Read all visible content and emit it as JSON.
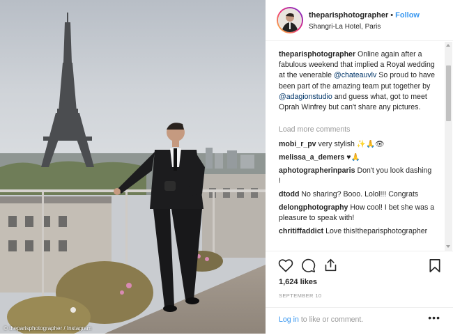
{
  "photo": {
    "watermark": "© theparisphotographer / Instagram"
  },
  "header": {
    "username": "theparisphotographer",
    "separator": "•",
    "follow_label": "Follow",
    "location": "Shangri-La Hotel, Paris"
  },
  "caption": {
    "username": "theparisphotographer",
    "part1": "Online again after a fabulous weekend that implied a Royal wedding at the venerable",
    "mention1": "@chateauvlv",
    "part2": "So proud to have been part of the amazing team put together by",
    "mention2": "@adagionstudio",
    "part3": "and guess what, got to meet Oprah Winfrey but can't share any pictures."
  },
  "load_more_label": "Load more comments",
  "comments": [
    {
      "username": "mobi_r_pv",
      "text": "very stylish ✨🙏👁"
    },
    {
      "username": "melissa_a_demers",
      "text": "♥🙏"
    },
    {
      "username": "aphotographerinparis",
      "text": "Don't you look dashing !"
    },
    {
      "username": "dtodd",
      "text": "No sharing? Booo. Lolol!!! Congrats"
    },
    {
      "username": "delongphotography",
      "text": "How cool! I bet she was a pleasure to speak with!"
    },
    {
      "username": "chritiffaddict",
      "text": "Love this!theparisphotographer"
    }
  ],
  "footer": {
    "icons": [
      "heart-icon",
      "comment-icon",
      "share-icon",
      "bookmark-icon"
    ],
    "likes": "1,624 likes",
    "date": "SEPTEMBER 10",
    "login_link": "Log in",
    "login_rest": "to like or comment.",
    "more_label": "•••"
  },
  "colors": {
    "link_blue": "#3897f0",
    "mention_blue": "#003569",
    "muted_gray": "#999999"
  }
}
